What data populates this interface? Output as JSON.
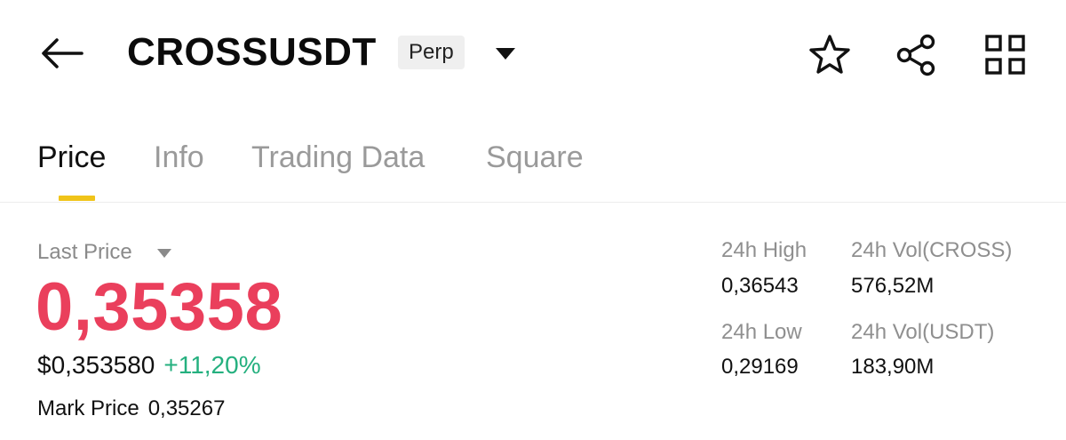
{
  "header": {
    "symbol": "CROSSUSDT",
    "badge": "Perp",
    "icons": [
      "back-arrow-icon",
      "caret-down-icon",
      "star-icon",
      "share-icon",
      "grid-icon"
    ]
  },
  "tabs": [
    {
      "label": "Price",
      "active": true
    },
    {
      "label": "Info",
      "active": false
    },
    {
      "label": "Trading Data",
      "active": false
    },
    {
      "label": "Square",
      "active": false
    }
  ],
  "price": {
    "last_label": "Last Price",
    "last_price": "0,35358",
    "usd_price": "$0,353580",
    "change": "+11,20%",
    "mark_label": "Mark Price",
    "mark_value": "0,35267"
  },
  "stats": {
    "high_label": "24h High",
    "high_value": "0,36543",
    "vol_cross_label": "24h Vol(CROSS)",
    "vol_cross_value": "576,52M",
    "low_label": "24h Low",
    "low_value": "0,29169",
    "vol_usdt_label": "24h Vol(USDT)",
    "vol_usdt_value": "183,90M"
  },
  "colors": {
    "price_red": "#ea3f5c",
    "change_green": "#25b07f",
    "tab_accent": "#f0c419",
    "muted_text": "#9a9a9a"
  }
}
